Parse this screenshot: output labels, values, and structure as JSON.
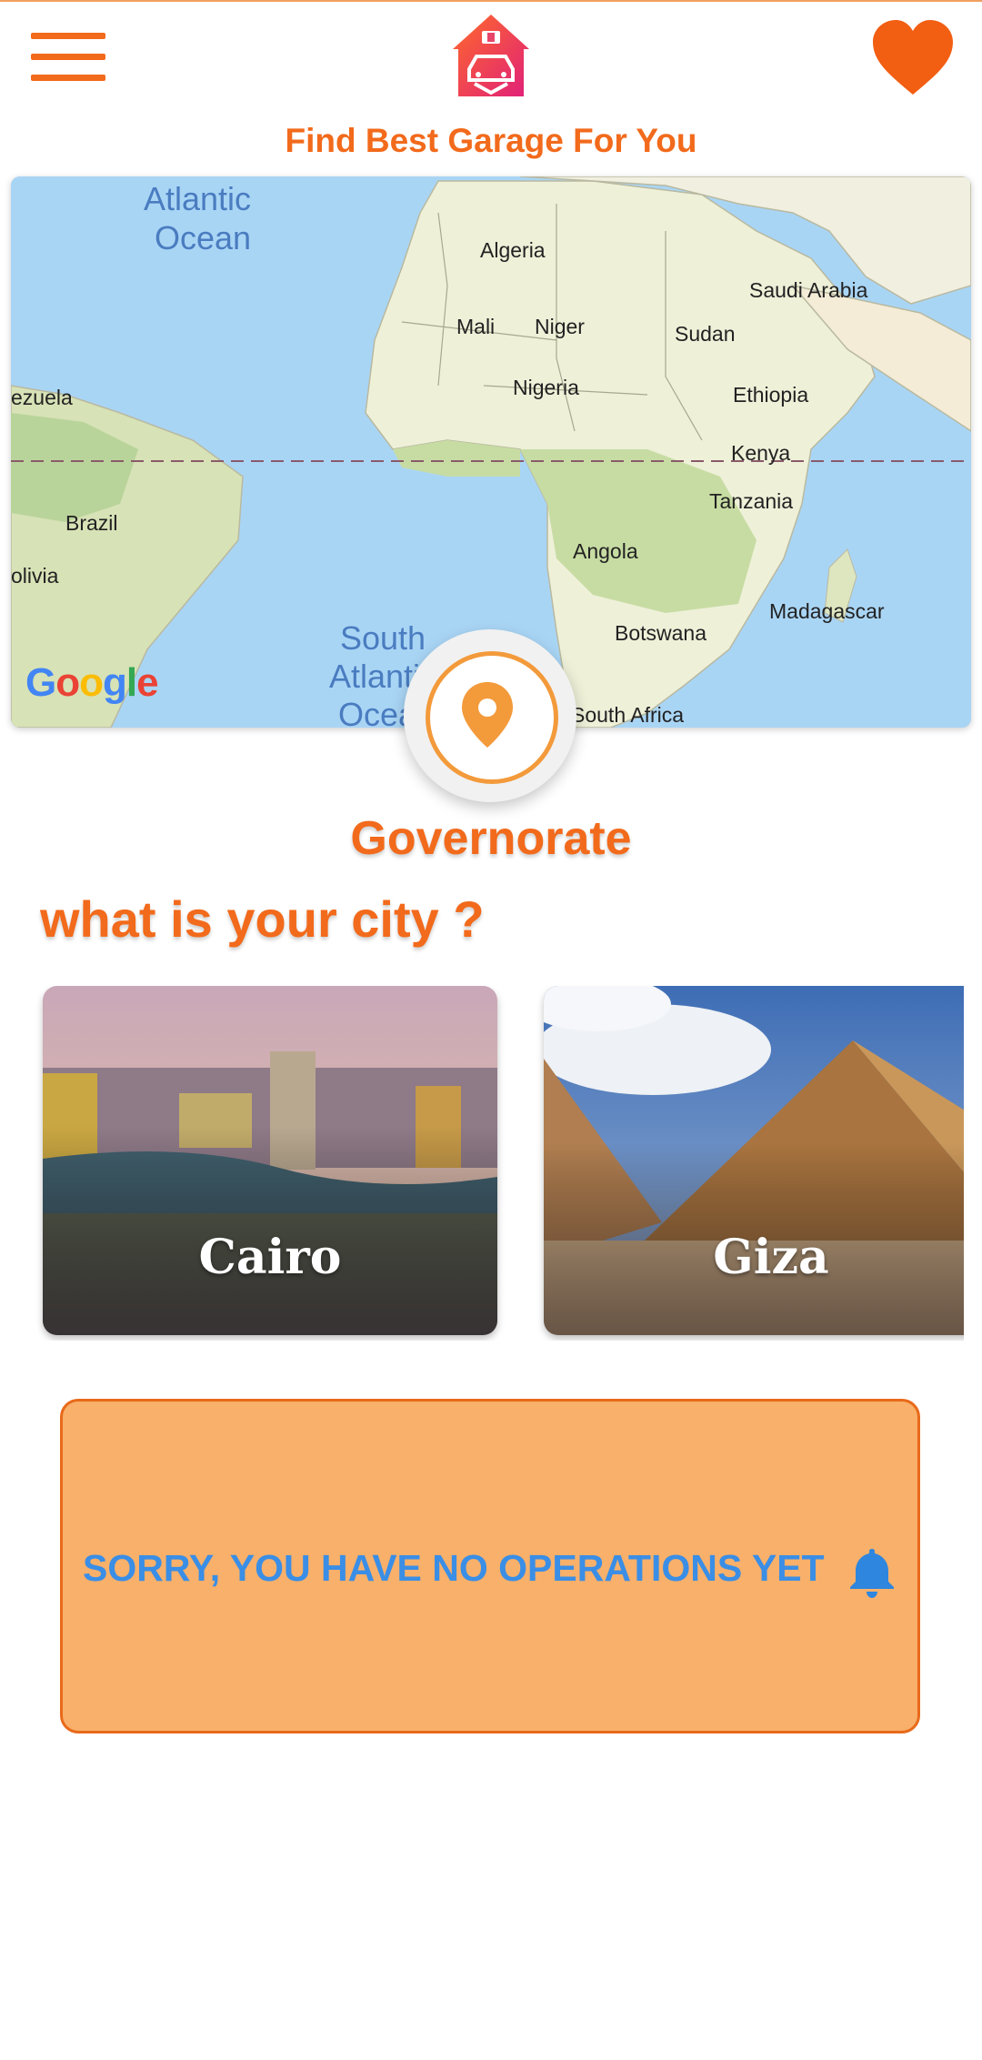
{
  "header": {
    "tagline": "Find Best Garage For You",
    "menu_icon": "hamburger-menu-icon",
    "logo_icon": "garage-car-logo",
    "favorite_icon": "heart-icon",
    "accent_color": "#f26a1b"
  },
  "map": {
    "provider_logo": "Google",
    "labels": {
      "atlantic_1": "Atlantic",
      "atlantic_2": "Ocean",
      "algeria": "Algeria",
      "saudi": "Saudi Arabia",
      "mali": "Mali",
      "niger": "Niger",
      "sudan": "Sudan",
      "venezuela": "ezuela",
      "nigeria": "Nigeria",
      "ethiopia": "Ethiopia",
      "kenya": "Kenya",
      "brazil": "Brazil",
      "tanzania": "Tanzania",
      "angola": "Angola",
      "bolivia": "olivia",
      "madagascar": "Madagascar",
      "south_1": "South",
      "south_2": "Atlantic",
      "south_3": "Ocea",
      "botswana": "Botswana",
      "south_africa": "South Africa"
    }
  },
  "location_button_icon": "map-pin-icon",
  "governorate_label": "Governorate",
  "city_question": "what is your city ?",
  "cities": [
    {
      "name": "Cairo"
    },
    {
      "name": "Giza"
    }
  ],
  "notice": {
    "message": "SORRY, YOU HAVE NO OPERATIONS YET",
    "icon": "bell-icon",
    "background": "#f8b06a",
    "text_color": "#3a8ee6"
  }
}
